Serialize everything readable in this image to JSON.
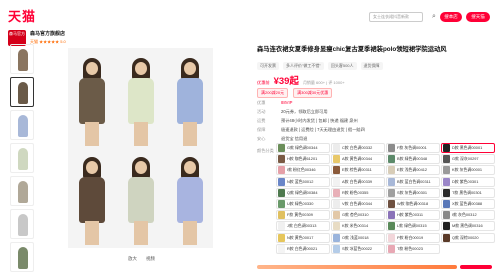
{
  "header": {
    "logo_text": "天猫",
    "search_placeholder": "女士连衣裙抖音新款",
    "btn_search_store": "搜本店",
    "btn_search_tmall": "搜天猫"
  },
  "store": {
    "logo_text": "森马官方",
    "name": "森马官方旗舰店",
    "rating": "天猫 ★★★★★ 5.0",
    "link_reviews": "店铺评价",
    "link_follow": "关注店铺"
  },
  "gallery": {
    "tool_zoom": "放大",
    "tool_video": "视频"
  },
  "product": {
    "title": "森马连衣裙女夏季修身显瘦chic复古夏季裙装polo领短裙学院运动风",
    "tags": [
      "可开发票",
      "多人评价\"做工不错\"",
      "回头客500人",
      "退货保障"
    ],
    "price_label": "优惠前",
    "price": "¥39起",
    "sales": "月销量 600+ | 评 1000+",
    "coupons": [
      "满200减20元",
      "满300减30元优惠"
    ]
  },
  "info": [
    {
      "label": "优惠",
      "value": "88VIP",
      "style": "red"
    },
    {
      "label": "活动",
      "value": "20元券，领取后立即可用",
      "style": ""
    },
    {
      "label": "运费",
      "value": "预计48小时内发货 | 包邮 | 快递 福建 泉州",
      "style": ""
    },
    {
      "label": "保障",
      "value": "极速退款 | 运费险 | 7天无理由退货 | 假一赔四",
      "style": ""
    },
    {
      "label": "安心",
      "value": "退货宝 信用退",
      "style": ""
    }
  ],
  "colors": {
    "label": "颜色分类",
    "items": [
      {
        "label": "G款 绿色调00344",
        "color": "#6b8e5a",
        "selected": false
      },
      {
        "label": "C款 白色调00332",
        "color": "#ececec",
        "selected": false
      },
      {
        "label": "F款 灰色调00001",
        "color": "#8c8c8c",
        "selected": false
      },
      {
        "label": "D款 黑色调00001",
        "color": "#222222",
        "selected": true
      },
      {
        "label": "H款 咖色调61201",
        "color": "#7a5a44",
        "selected": false
      },
      {
        "label": "A款 黄色调00344",
        "color": "#e8c86a",
        "selected": false
      },
      {
        "label": "B款 绿色调00348",
        "color": "#5c8a6a",
        "selected": false
      },
      {
        "label": "G款 深灰00297",
        "color": "#555555",
        "selected": false
      },
      {
        "label": "I款 粉红色00346",
        "color": "#e5a0a8",
        "selected": false
      },
      {
        "label": "E款 棕色调00311",
        "color": "#8b5a3a",
        "selected": false
      },
      {
        "label": "E款 浅色调00412",
        "color": "#d8cdb8",
        "selected": false
      },
      {
        "label": "K款 灰色调00001",
        "color": "#9a9a9a",
        "selected": false
      },
      {
        "label": "N款 蓝色50012",
        "color": "#6a86c8",
        "selected": false
      },
      {
        "label": "A款 白色调00339",
        "color": "#f2f2f2",
        "selected": false
      },
      {
        "label": "B款 蓝白色调00311",
        "color": "#a8b8d8",
        "selected": false
      },
      {
        "label": "D款 紫色00301",
        "color": "#9a86c8",
        "selected": false
      },
      {
        "label": "Q款 绿色调00384",
        "color": "#4f7a4f",
        "selected": false
      },
      {
        "label": "R款 粉色00355",
        "color": "#e8b0b8",
        "selected": false
      },
      {
        "label": "S款 灰色调00301",
        "color": "#a0a0a0",
        "selected": false
      },
      {
        "label": "T款 黑色调00301",
        "color": "#2a2a2a",
        "selected": false
      },
      {
        "label": "U款 绿色00330",
        "color": "#6a9a6a",
        "selected": false
      },
      {
        "label": "V款 白色调00344",
        "color": "#ededed",
        "selected": false
      },
      {
        "label": "W款 咖色调00318",
        "color": "#6e5040",
        "selected": false
      },
      {
        "label": "X款 蓝色调00388",
        "color": "#5a78b8",
        "selected": false
      },
      {
        "label": "F款 黄色00309",
        "color": "#e0c060",
        "selected": false
      },
      {
        "label": "G款 杏色00310",
        "color": "#e2c8a8",
        "selected": false
      },
      {
        "label": "H款 紫色00311",
        "color": "#8a72b8",
        "selected": false
      },
      {
        "label": "I款 灰色00312",
        "color": "#888888",
        "selected": false
      },
      {
        "label": "J款 白色调00313",
        "color": "#f0f0f0",
        "selected": false
      },
      {
        "label": "K款 米色00314",
        "color": "#e8dcc4",
        "selected": false
      },
      {
        "label": "L款 绿色调00315",
        "color": "#5a8a5a",
        "selected": false
      },
      {
        "label": "M款 黑色调00316",
        "color": "#1e1e1e",
        "selected": false
      },
      {
        "label": "N款 黄色00017",
        "color": "#e6c65c",
        "selected": false
      },
      {
        "label": "O款 浅蓝00018",
        "color": "#9ab4dc",
        "selected": false
      },
      {
        "label": "P款 粉白00019",
        "color": "#f2d6da",
        "selected": false
      },
      {
        "label": "Q款 深棕00020",
        "color": "#5a3a28",
        "selected": false
      },
      {
        "label": "R款 白色调00021",
        "color": "#f4f4f4",
        "selected": false
      },
      {
        "label": "S款 冰蓝色00022",
        "color": "#b4cce8",
        "selected": false
      },
      {
        "label": "T款 粉色00023",
        "color": "#e8a8b4",
        "selected": false
      }
    ]
  },
  "thumbs": [
    "#8a7560",
    "#6a5a48",
    "#a8b8d8",
    "#cfd8c0",
    "#b0a898",
    "#c8c8c8",
    "#7a8a6a"
  ],
  "tiles": [
    {
      "dress": "#6b5b48"
    },
    {
      "dress": "#dde6c8"
    },
    {
      "dress": "#9fb3dc"
    },
    {
      "dress": "#5e4a3a"
    },
    {
      "dress": "#cfd4c0"
    },
    {
      "dress": "#a8b4e0"
    }
  ]
}
